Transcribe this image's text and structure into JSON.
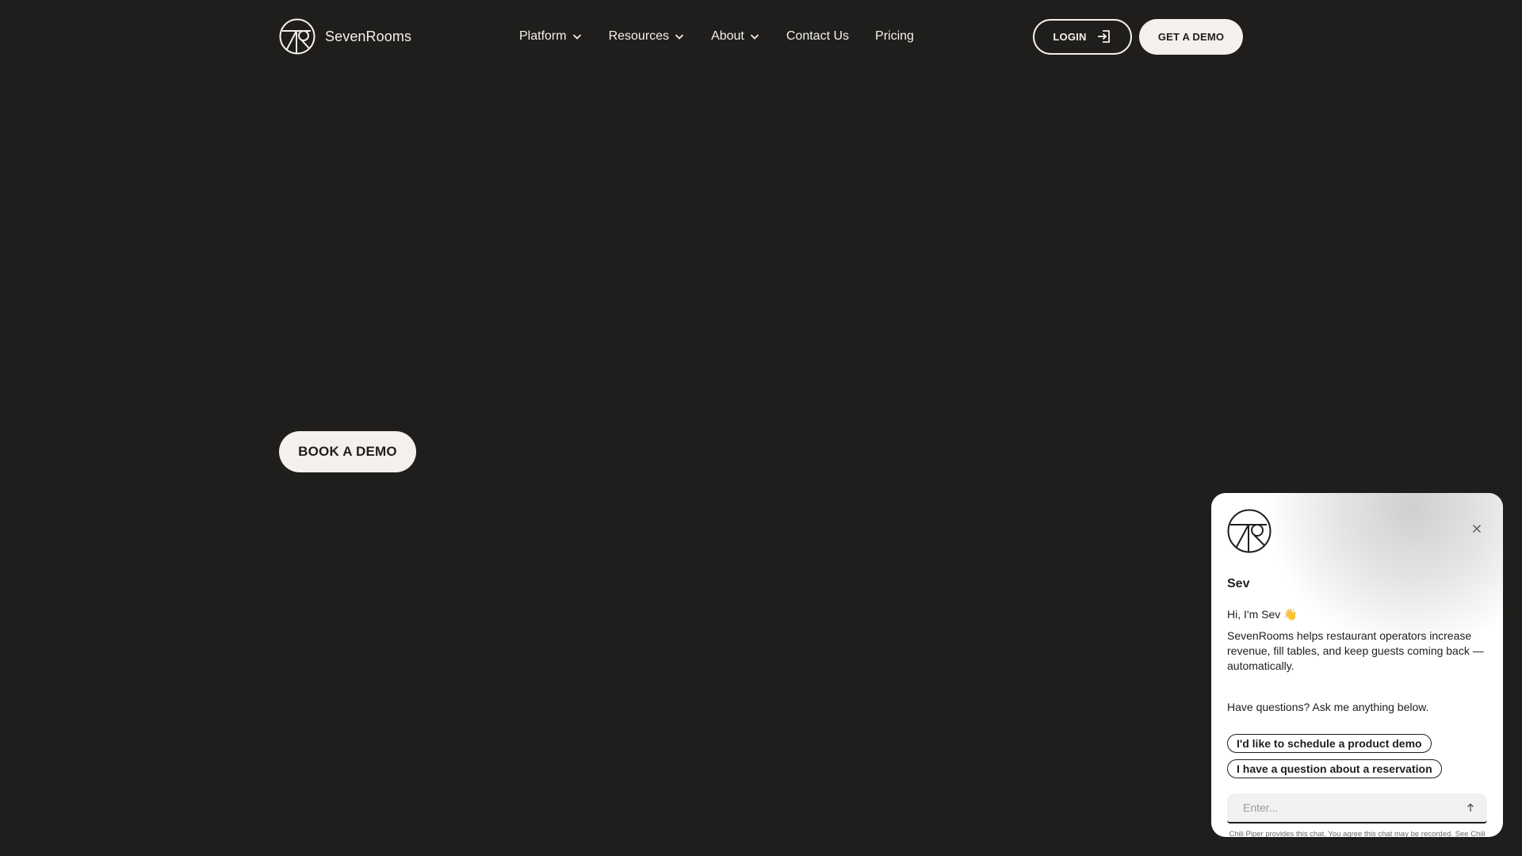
{
  "brand": {
    "name": "SevenRooms",
    "logo_icon": "sevenrooms-logo-icon"
  },
  "nav": {
    "items": [
      {
        "label": "Platform",
        "has_dropdown": true
      },
      {
        "label": "Resources",
        "has_dropdown": true
      },
      {
        "label": "About",
        "has_dropdown": true
      },
      {
        "label": "Contact Us",
        "has_dropdown": false
      },
      {
        "label": "Pricing",
        "has_dropdown": false
      }
    ]
  },
  "header_actions": {
    "login_label": "LOGIN",
    "login_icon": "login-arrow-icon",
    "demo_label": "GET A DEMO"
  },
  "hero": {
    "cta_label": "BOOK A DEMO"
  },
  "chat": {
    "bot_name": "Sev",
    "greeting": "Hi, I'm Sev 👋",
    "intro": "SevenRooms helps restaurant operators increase revenue, fill tables, and keep guests coming back — automatically.",
    "prompt": "Have questions? Ask me anything below.",
    "quick_replies": [
      "I'd like to schedule a product demo",
      "I have a question about a reservation"
    ],
    "input_placeholder": "Enter...",
    "footer_text": "Chili Piper provides this chat. You agree this chat may be recorded. See",
    "footer_link": "Chili Piper's Privacy Statement",
    "footer_end": "."
  },
  "colors": {
    "background": "#1f1e1c",
    "cream": "#f4f1ec",
    "widget_bg": "#ffffff"
  }
}
